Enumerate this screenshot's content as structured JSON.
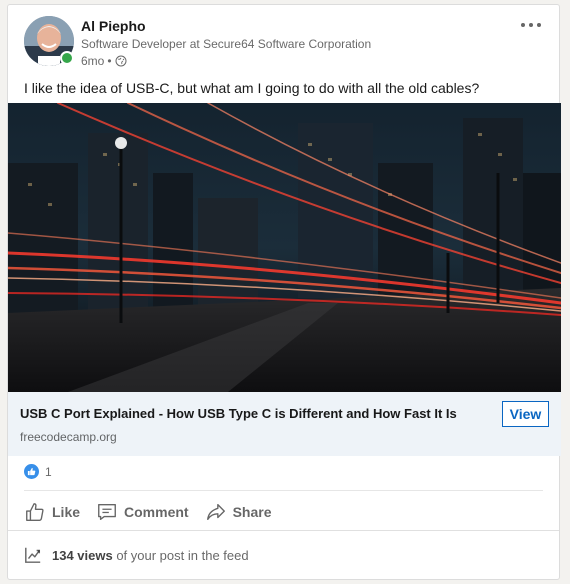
{
  "post": {
    "author_name": "Al Piepho",
    "author_headline": "Software Developer at Secure64 Software Corporation",
    "time_ago": "6mo",
    "separator": "•",
    "text": "I like the idea of USB-C, but what am I going to do with all the old cables?"
  },
  "article": {
    "title": "USB C Port Explained - How USB Type C is Different and How Fast It Is",
    "source": "freecodecamp.org",
    "view_label": "View"
  },
  "social": {
    "reaction_count": "1"
  },
  "actions": {
    "like": "Like",
    "comment": "Comment",
    "share": "Share"
  },
  "analytics": {
    "views": "134 views",
    "suffix": " of your post in the feed"
  },
  "icons": {
    "more": "more-horizontal-icon",
    "visibility": "globe-icon",
    "like": "thumbs-up-icon",
    "comment": "comment-icon",
    "share": "share-arrow-icon",
    "analytics": "trending-chart-icon"
  },
  "colors": {
    "accent": "#0a66c2",
    "presence": "#35a64a",
    "like_reaction": "#378fe9",
    "article_meta_bg": "#eef3f8"
  }
}
